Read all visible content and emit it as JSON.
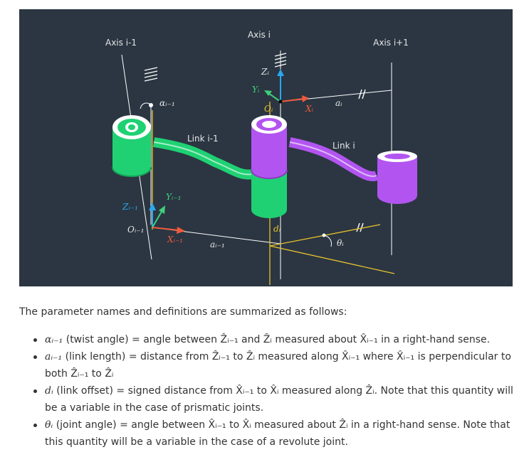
{
  "figure": {
    "labels": {
      "axis_prev": "Axis i-1",
      "axis_i": "Axis i",
      "axis_next": "Axis i+1",
      "link_prev": "Link i-1",
      "link_i": "Link i",
      "alpha_prev": "αᵢ₋₁",
      "z_i": "Zᵢ",
      "y_i": "Yᵢ",
      "o_i": "Oᵢ",
      "x_i": "Xᵢ",
      "a_i": "aᵢ",
      "z_prev": "Zᵢ₋₁",
      "y_prev": "Yᵢ₋₁",
      "o_prev": "Oᵢ₋₁",
      "x_prev": "Xᵢ₋₁",
      "a_prev": "aᵢ₋₁",
      "d_i": "dᵢ",
      "theta_i": "θᵢ"
    },
    "colors": {
      "background": "#2b3642",
      "green": "#1fd173",
      "purple": "#b255f0",
      "axis_yellow": "#e8c22a",
      "z_blue": "#2aa7ee",
      "y_green": "#3fd07a",
      "x_red": "#f05a3c"
    }
  },
  "text": {
    "intro": "The parameter names and definitions are summarized as follows:",
    "bullets": [
      {
        "sym": "αᵢ₋₁",
        "text": " (twist angle) = angle between Ẑᵢ₋₁ and Ẑᵢ measured about X̂ᵢ₋₁ in a right-hand sense."
      },
      {
        "sym": "aᵢ₋₁",
        "text": " (link length) = distance from Ẑᵢ₋₁ to Ẑᵢ measured along X̂ᵢ₋₁ where X̂ᵢ₋₁ is perpendicular to both Ẑᵢ₋₁ to Ẑᵢ"
      },
      {
        "sym": "dᵢ",
        "text": " (link offset) = signed distance from X̂ᵢ₋₁ to X̂ᵢ measured along Ẑᵢ. Note that this quantity will be a variable in the case of prismatic joints."
      },
      {
        "sym": "θᵢ",
        "text": " (joint angle) = angle between X̂ᵢ₋₁ to X̂ᵢ measured about Ẑᵢ in a right-hand sense. Note that this quantity will be a variable in the case of a revolute joint."
      }
    ]
  }
}
